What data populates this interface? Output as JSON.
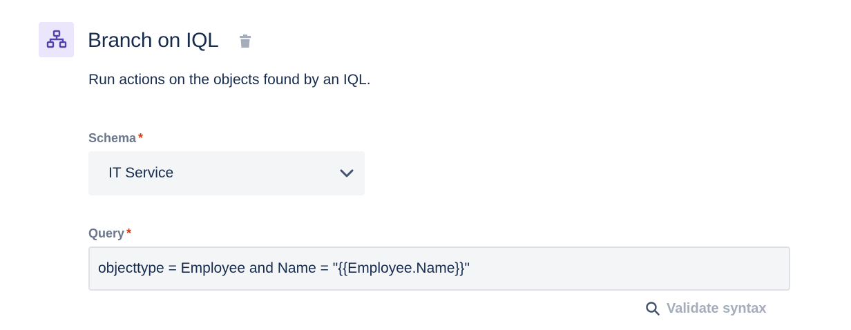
{
  "header": {
    "icon": "branch-hierarchy-icon",
    "title": "Branch on IQL",
    "delete_icon": "trash-icon"
  },
  "description": "Run actions on the objects found by an IQL.",
  "schema": {
    "label": "Schema",
    "required_mark": "*",
    "value": "IT Service"
  },
  "query": {
    "label": "Query",
    "required_mark": "*",
    "value": "objecttype = Employee and Name = \"{{Employee.Name}}\""
  },
  "validate": {
    "icon": "search-icon",
    "label": "Validate syntax"
  },
  "colors": {
    "text": "#172b4d",
    "muted": "#6b778c",
    "required": "#de350b",
    "icon_accent": "#5243aa",
    "icon_bg": "#ebe6fb",
    "field_bg": "#f4f5f7",
    "disabled": "#a5adba"
  }
}
